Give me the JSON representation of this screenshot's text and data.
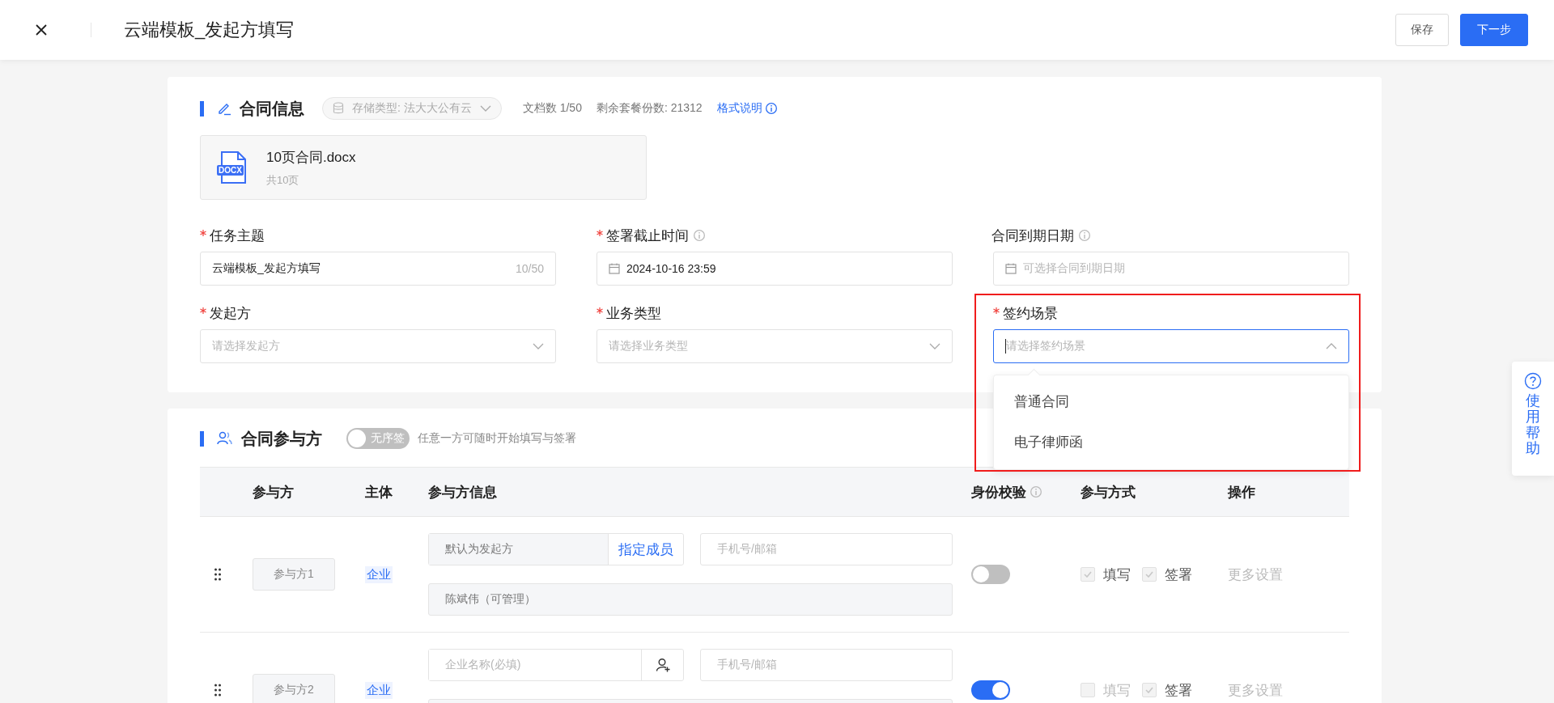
{
  "header": {
    "title": "云端模板_发起方填写",
    "buttons": [
      {
        "label": "保存",
        "kind": "default"
      },
      {
        "label": "下一步",
        "kind": "primary"
      }
    ]
  },
  "contract_info": {
    "title": "合同信息",
    "storage": {
      "value": "存储类型: 法大大公有云",
      "disabled": true
    },
    "doc_count": "文档数 1/50",
    "remaining": "剩余套餐份数: 21312",
    "format_link": "格式说明",
    "file": {
      "badge": "DOCX",
      "name": "10页合同.docx",
      "pages": "共10页"
    },
    "fields": [
      {
        "kind": "text",
        "label": "任务主题",
        "required": true,
        "info": false,
        "value": "云端模板_发起方填写",
        "counter": "10/50"
      },
      {
        "kind": "date",
        "label": "签署截止时间",
        "required": true,
        "info": true,
        "value": "2024-10-16 23:59"
      },
      {
        "kind": "date",
        "label": "合同到期日期",
        "required": false,
        "info": true,
        "placeholder": "可选择合同到期日期"
      },
      {
        "kind": "select",
        "label": "发起方",
        "required": true,
        "info": false,
        "placeholder": "请选择发起方",
        "open": false
      },
      {
        "kind": "select",
        "label": "业务类型",
        "required": true,
        "info": false,
        "placeholder": "请选择业务类型",
        "open": false
      },
      {
        "kind": "select",
        "label": "签约场景",
        "required": true,
        "info": false,
        "placeholder": "请选择签约场景",
        "open": true,
        "highlighted": true,
        "options": [
          {
            "label": "普通合同",
            "selected": false
          },
          {
            "label": "电子律师函",
            "selected": false
          }
        ]
      }
    ]
  },
  "participants": {
    "title": "合同参与方",
    "order_toggle": {
      "label": "无序签",
      "on": false
    },
    "hint": "任意一方可随时开始填写与签署",
    "columns": [
      {
        "label": "参与方",
        "info": false
      },
      {
        "label": "主体",
        "info": false
      },
      {
        "label": "参与方信息",
        "info": false
      },
      {
        "label": "身份校验",
        "info": true
      },
      {
        "label": "参与方式",
        "info": false
      },
      {
        "label": "操作",
        "info": false
      }
    ],
    "rows": [
      {
        "party": "参与方1",
        "entity": "企业",
        "company": {
          "kind": "filled",
          "value": "默认为发起方"
        },
        "action": {
          "kind": "text",
          "label": "指定成员"
        },
        "contact_placeholder": "手机号/邮箱",
        "member": "陈斌伟（可管理）",
        "verify": false,
        "modes": [
          {
            "label": "填写",
            "checked": true
          },
          {
            "label": "签署",
            "checked": true
          }
        ],
        "more": "更多设置"
      },
      {
        "party": "参与方2",
        "entity": "企业",
        "company": {
          "kind": "empty",
          "placeholder": "企业名称(必填)"
        },
        "action": {
          "kind": "icon"
        },
        "contact_placeholder": "手机号/邮箱",
        "verify": true,
        "modes": [
          {
            "label": "填写",
            "checked": false
          },
          {
            "label": "签署",
            "checked": true
          }
        ],
        "more": "更多设置"
      }
    ]
  },
  "help": {
    "label": "使用帮助"
  }
}
